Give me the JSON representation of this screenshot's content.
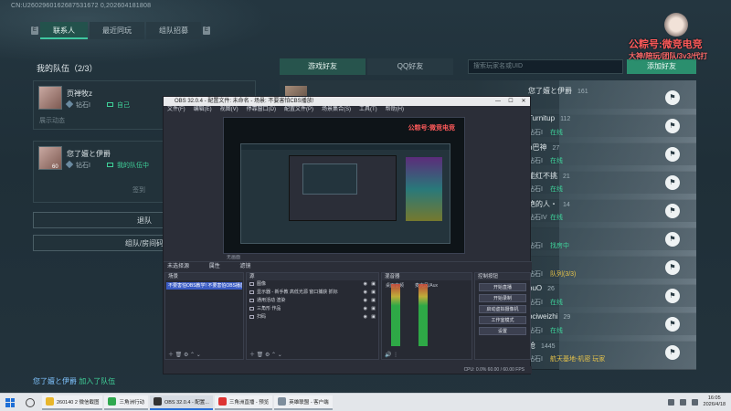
{
  "topbar": {
    "id_text": "CN:U2602960162687531672 0,202604181808"
  },
  "tabs": [
    {
      "label": "联系人",
      "active": true
    },
    {
      "label": "最近同玩",
      "active": false
    },
    {
      "label": "组队招募",
      "active": false
    }
  ],
  "tab_marker": "E",
  "team": {
    "title": "我的队伍（2/3）",
    "members": [
      {
        "name": "页禅牧z",
        "rank": "钻石I",
        "status": "自己",
        "hint": "展示动态"
      },
      {
        "name": "您了嬗と伊爵",
        "level": "60",
        "rank": "钻石I",
        "status": "我的队伍中",
        "hint": "签到"
      }
    ],
    "leave_button": "退队",
    "room_button": "组队/房间码"
  },
  "joined_message": {
    "name": "您了嬗と伊爵",
    "text": " 加入了队伍"
  },
  "friends": {
    "tabs": [
      {
        "label": "游戏好友",
        "active": true
      },
      {
        "label": "QQ好友",
        "active": false
      }
    ],
    "search_placeholder": "搜索玩家名或UID",
    "add_button": "添加好友",
    "list": [
      {
        "name": "您了嬗と伊爵",
        "num": "161",
        "rank": "",
        "status": ""
      },
      {
        "name": "Turnitup",
        "num": "112",
        "rank": "钻石I",
        "status": "在线"
      },
      {
        "name": "p巴神",
        "num": "27",
        "rank": "钻石I",
        "status": "在线"
      },
      {
        "name": "能红不挑",
        "num": "21",
        "rank": "钻石I",
        "status": "在线"
      },
      {
        "name": "绝的人・",
        "num": "14",
        "rank": "钻石IV",
        "status": "在线"
      },
      {
        "name": "",
        "num": "",
        "rank": "钻石I",
        "status": "找房中"
      },
      {
        "name": "",
        "num": "",
        "rank": "钻石I",
        "status": "队列(3/3)",
        "busy": true
      },
      {
        "name": "ouO",
        "num": "26",
        "rank": "钻石I",
        "status": "在线"
      },
      {
        "name": "ociweizhi",
        "num": "29",
        "rank": "钻石I",
        "status": "在线"
      },
      {
        "name": "枪",
        "num": "1445",
        "rank": "钻石I",
        "status": "航天基地-机密 玩家",
        "busy": true
      }
    ]
  },
  "promo": {
    "line1": "公粽号:微竞电竞",
    "line2": "大神/陪玩/团队/3v3/代打"
  },
  "obs": {
    "title": "OBS 32.0.4 - 配置文件: 未命名 - 场景: 不要害怕CBS播放!",
    "menu": [
      "文件(F)",
      "编辑(E)",
      "视图(V)",
      "停靠窗口(D)",
      "配置文件(P)",
      "场景集合(S)",
      "工具(T)",
      "帮助(H)"
    ],
    "preview_label": "无画面",
    "control_bar": {
      "source": "未选择源",
      "props": "属性",
      "filters": "滤镜"
    },
    "docks": {
      "scenes": {
        "title": "场景",
        "items": [
          "不要害怕OBS教学! 不要害怕OBS播放!"
        ]
      },
      "sources": {
        "title": "源",
        "items": [
          "图像",
          "显示器 - 新手教 高低光源 窗口捕获 抓标",
          "通用活动 渲染",
          "三角形 作品",
          "扫码"
        ]
      },
      "mixer": {
        "title": "混音器",
        "ch1": "桌面音频",
        "ch2": "麦克风/Aux"
      },
      "controls": {
        "title": "控制按钮",
        "buttons": [
          "开始直播",
          "开始录制",
          "启动虚拟摄像机",
          "工作室模式",
          "设置"
        ]
      }
    },
    "status": "CPU: 0.0%   60.00 / 60.00 FPS"
  },
  "taskbar": {
    "apps": [
      {
        "label": "260140 2  微信截图",
        "color": "#e8b62c",
        "active": false
      },
      {
        "label": "三角洲行动",
        "color": "#2fa84f",
        "active": false
      },
      {
        "label": "OBS 32.0.4 - 配置...",
        "color": "#333333",
        "active": true
      },
      {
        "label": "三角洲直播 - 预览",
        "color": "#d33",
        "active": false
      },
      {
        "label": "英雄联盟 - 客户端",
        "color": "#7d8d9c",
        "active": false
      }
    ],
    "time": "16:05",
    "date": "2026/4/18"
  }
}
